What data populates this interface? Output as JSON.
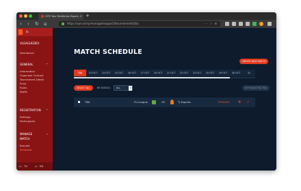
{
  "browser": {
    "tab_title": "VITE Your Realtimes Esport...",
    "tab_close": "×",
    "new_tab": "+",
    "url": "https://vpe.army/manage/league/3/tournaments/tba",
    "url_actions": "··· ☆ ⊞",
    "nav": {
      "back": "‹",
      "forward": "›",
      "reload": "↻",
      "home": "⌂"
    }
  },
  "sidebar": {
    "user": "lb",
    "org": "VLEAGUEDEV",
    "dashboard": "Dashboard",
    "general": {
      "title": "GENERAL",
      "items": [
        "Information",
        "Organiser Contact",
        "Tournament Detail",
        "Prize",
        "Rules",
        "Staffs"
      ]
    },
    "registration": {
      "title": "REGISTRATION",
      "items": [
        "Settings",
        "Participants"
      ]
    },
    "manage_match": {
      "title": "MANAGE MATCH",
      "items": [
        "Bracket",
        "Schedule"
      ]
    },
    "footer": {
      "lang1": "TH",
      "lang2": "EN"
    }
  },
  "main": {
    "title": "MATCH SCHEDULE",
    "create_button": "CREATE NEW MATCH",
    "dates": [
      "TBA",
      "13 OCT",
      "14 OCT",
      "15 OCT",
      "16 OCT",
      "17 OCT",
      "20 OCT",
      "21 OCT",
      "22 OCT",
      "23 OCT",
      "24 OCT",
      "29 OCT",
      "30 OCT",
      "31"
    ],
    "active_date": "TBA",
    "date_scroll_position": 0.86,
    "select_all": "SELECT ALL",
    "status_label": "BY STATUS :",
    "status_value": "ALL",
    "set_button": "SET SELECTED TBA",
    "match": {
      "date": "TBA",
      "team1": "FU-League",
      "vs": "VS",
      "team2": "TJ Esports",
      "status": "PENDING"
    }
  },
  "colors": {
    "accent": "#e23a1f",
    "sidebar": "#8a1414",
    "background": "#0d1b2d"
  }
}
